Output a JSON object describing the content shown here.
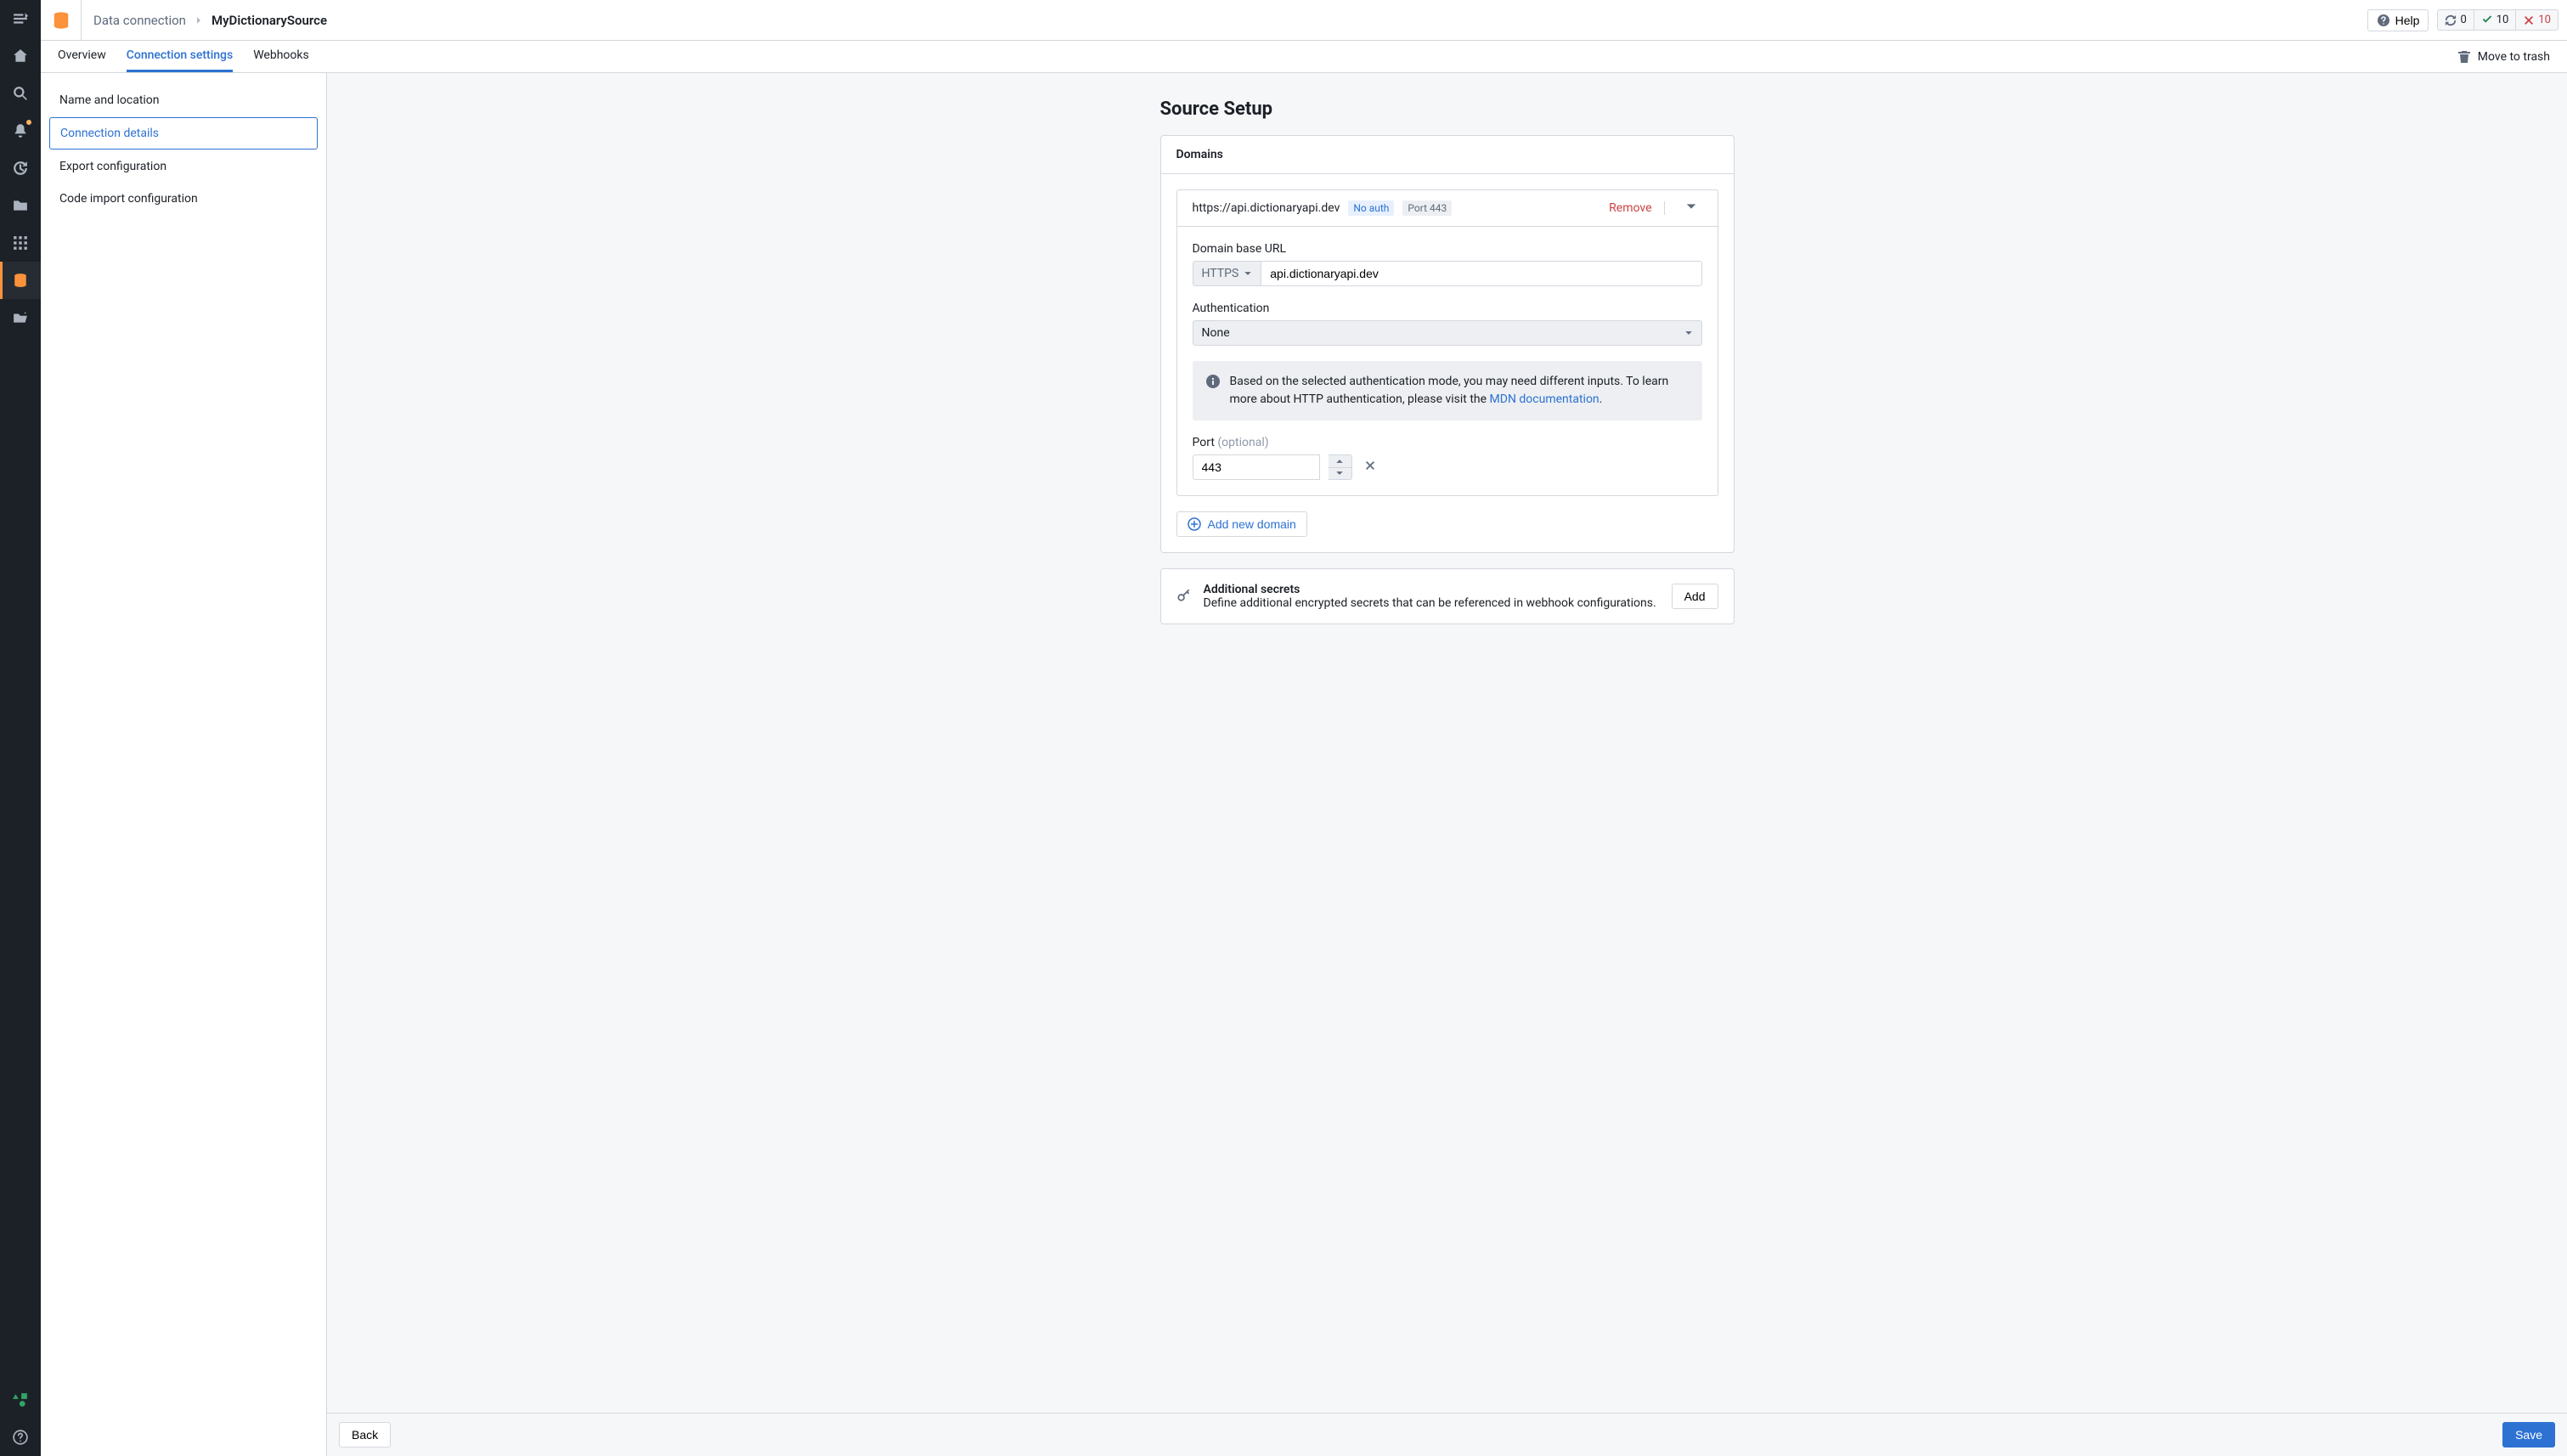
{
  "breadcrumb": {
    "root": "Data connection",
    "current": "MyDictionarySource"
  },
  "topbar": {
    "help": "Help",
    "status": {
      "sync": "0",
      "ok": "10",
      "err": "10"
    }
  },
  "tabs": {
    "overview": "Overview",
    "connection_settings": "Connection settings",
    "webhooks": "Webhooks",
    "move_to_trash": "Move to trash"
  },
  "subnav": {
    "name_location": "Name and location",
    "connection_details": "Connection details",
    "export_config": "Export configuration",
    "code_import": "Code import configuration"
  },
  "page_title": "Source Setup",
  "domains_header": "Domains",
  "domain": {
    "url": "https://api.dictionaryapi.dev",
    "noauth_pill": "No auth",
    "port_pill": "Port 443",
    "remove": "Remove",
    "field_url_label": "Domain base URL",
    "proto": "HTTPS",
    "host": "api.dictionaryapi.dev",
    "auth_label": "Authentication",
    "auth_value": "None",
    "callout_a": "Based on the selected authentication mode, you may need different inputs. To learn more about HTTP authentication, please visit the ",
    "callout_link": "MDN documentation",
    "callout_b": ".",
    "port_label": "Port ",
    "port_optional": "(optional)",
    "port_value": "443"
  },
  "add_domain": "Add new domain",
  "secrets": {
    "title": "Additional secrets",
    "desc": "Define additional encrypted secrets that can be referenced in webhook configurations.",
    "add": "Add"
  },
  "footer": {
    "back": "Back",
    "save": "Save"
  }
}
